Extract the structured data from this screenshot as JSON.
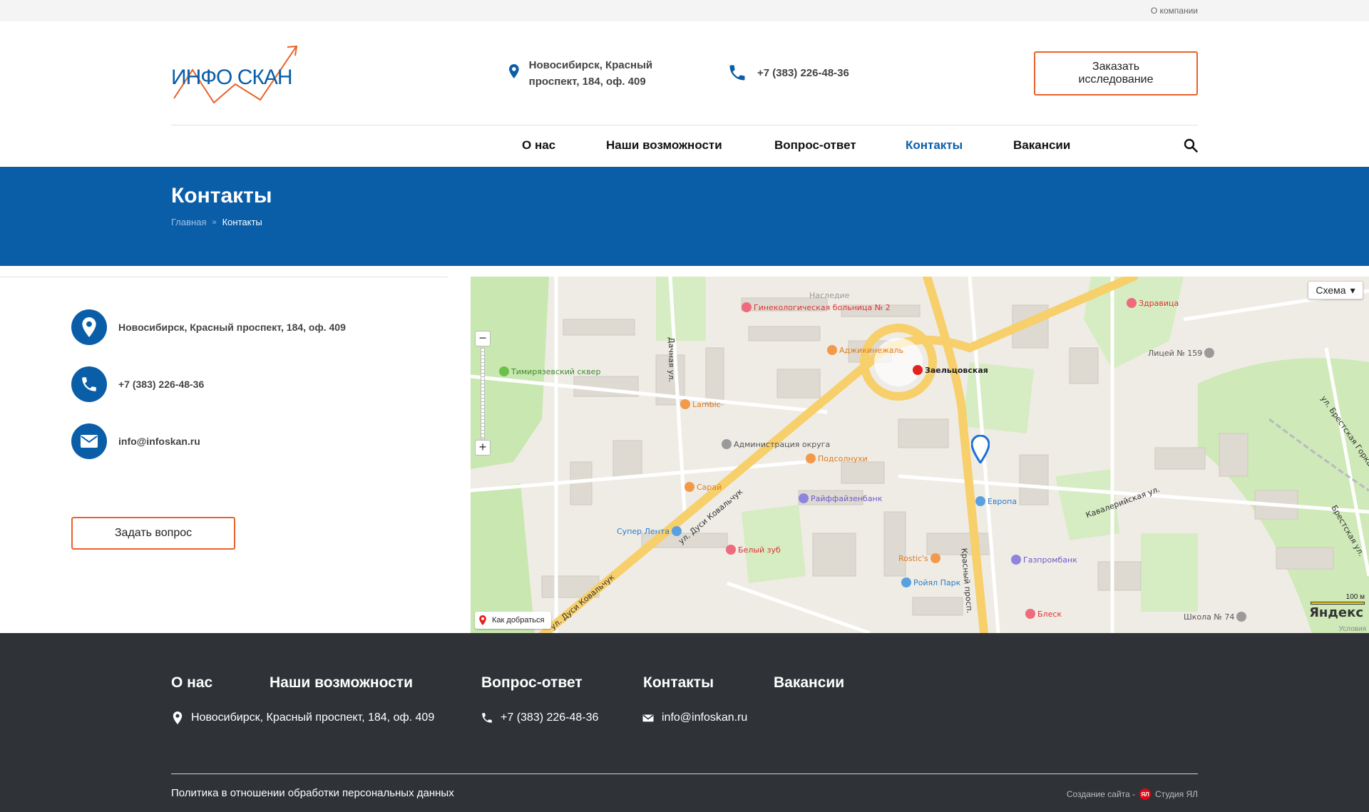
{
  "topbar": {
    "about_link": "О компании"
  },
  "header": {
    "logo_text": "ИНФО СКАН",
    "address": "Новосибирск,  Красный проспект, 184, оф. 409",
    "phone": "+7 (383) 226-48-36",
    "order_button": "Заказать исследование"
  },
  "nav": {
    "items": [
      {
        "label": "О нас"
      },
      {
        "label": "Наши возможности"
      },
      {
        "label": "Вопрос-ответ"
      },
      {
        "label": "Контакты",
        "active": true
      },
      {
        "label": "Вакансии"
      }
    ]
  },
  "banner": {
    "title": "Контакты",
    "breadcrumb": {
      "home": "Главная",
      "separator": "»",
      "current": "Контакты"
    }
  },
  "contacts": {
    "address": "Новосибирск,  Красный проспект, 184, оф. 409",
    "phone": "+7 (383) 226-48-36",
    "email": "info@infoskan.ru",
    "ask_button": "Задать вопрос"
  },
  "map": {
    "type_selector": "Схема",
    "route_button": "Как добраться",
    "scale_label": "100 м",
    "logo": "Яндекс",
    "terms": "Условия",
    "labels": {
      "l1": "Наследие",
      "l2": "Гинекологическая больница № 2",
      "l3": "Аджикинежаль",
      "l4": "Заельцовская",
      "l5": "Тимирязевский сквер",
      "l6": "Lambic",
      "l7": "Администрация округа",
      "l8": "Подсолнухи",
      "l9": "Сарай",
      "l10": "Райффайзенбанк",
      "l11": "Европа",
      "l12": "Супер Лента",
      "l13": "Белый зуб",
      "l14": "Rostic's",
      "l15": "Ройял Парк",
      "l16": "Газпромбанк",
      "l17": "Блеск",
      "l18": "Здравица",
      "l19": "Лицей № 159",
      "l20": "Школа № 74",
      "l21": "ул. Дуси Ковальчук",
      "l22": "ул. Дуси Ковальчук",
      "l23": "Красный просп.",
      "l24": "Кавалерийская ул.",
      "l25": "Дачная ул.",
      "l26": "ул. Брестская Горка",
      "l27": "Брестская ул."
    }
  },
  "footer": {
    "nav": [
      "О нас",
      "Наши возможности",
      "Вопрос-ответ",
      "Контакты",
      "Вакансии"
    ],
    "address": "Новосибирск,  Красный проспект, 184, оф. 409",
    "phone": "+7 (383) 226-48-36",
    "email": "info@infoskan.ru",
    "policy": "Политика в отношении обработки персональных данных",
    "credit_prefix": "Создание сайта -",
    "credit_badge": "ЯЛ",
    "credit_studio": "Студия ЯЛ"
  },
  "colors": {
    "brand_blue": "#0a5ea8",
    "accent_orange": "#e8622a",
    "footer_bg": "#2f3338"
  }
}
